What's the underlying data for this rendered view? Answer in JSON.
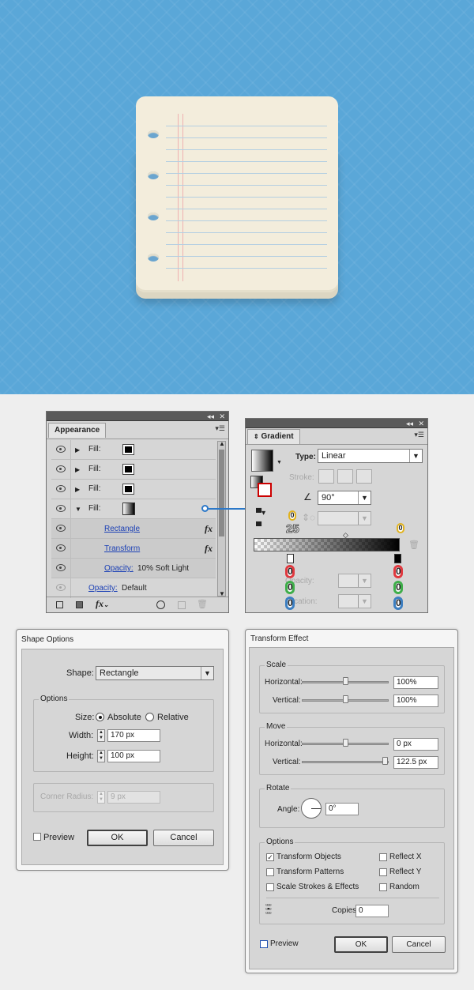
{
  "appearance": {
    "tab": "Appearance",
    "rows": [
      {
        "label": "Fill:"
      },
      {
        "label": "Fill:"
      },
      {
        "label": "Fill:"
      },
      {
        "label": "Fill:"
      }
    ],
    "effect_rectangle": "Rectangle",
    "effect_transform": "Transform",
    "opacity_label": "Opacity:",
    "opacity_value": "10% Soft Light",
    "opacity_label_2": "Opacity:",
    "opacity_value_2": "Default",
    "fx": "fx"
  },
  "gradient": {
    "tab": "Gradient",
    "type_label": "Type:",
    "type_value": "Linear",
    "stroke_label": "Stroke:",
    "angle_value": "90°",
    "location_value": "25",
    "opacity_label": "Opacity:",
    "location_label": "Location:",
    "callouts": [
      "0",
      "0",
      "0",
      "0",
      "0",
      "0",
      "0",
      "0"
    ]
  },
  "shape_options": {
    "title": "Shape Options",
    "shape_label": "Shape:",
    "shape_value": "Rectangle",
    "options_legend": "Options",
    "size_label": "Size:",
    "absolute": "Absolute",
    "relative": "Relative",
    "width_label": "Width:",
    "width_value": "170 px",
    "height_label": "Height:",
    "height_value": "100 px",
    "corner_label": "Corner Radius:",
    "corner_value": "9 px",
    "preview": "Preview",
    "ok": "OK",
    "cancel": "Cancel"
  },
  "transform": {
    "title": "Transform Effect",
    "scale": "Scale",
    "horizontal": "Horizontal:",
    "vertical": "Vertical:",
    "scale_h": "100%",
    "scale_v": "100%",
    "scale_h_level": 0.5,
    "scale_v_level": 0.5,
    "move": "Move",
    "move_h": "0 px",
    "move_v": "122.5 px",
    "move_h_level": 0.5,
    "move_v_level": 1.0,
    "horizontal_2": "Horizontal:",
    "vertical_2": "Vertical:",
    "rotate": "Rotate",
    "angle_label": "Angle:",
    "angle_value": "0°",
    "options": "Options",
    "transform_objects": "Transform Objects",
    "transform_patterns": "Transform Patterns",
    "scale_strokes": "Scale Strokes & Effects",
    "reflect_x": "Reflect X",
    "reflect_y": "Reflect Y",
    "random": "Random",
    "copies_label": "Copies",
    "copies_value": "0",
    "preview": "Preview",
    "ok": "OK",
    "cancel": "Cancel"
  },
  "colors": {
    "canvas": "#5aa7d8",
    "paper": "#f3eddc",
    "red": "#e0393f",
    "green": "#3fae4a",
    "blue": "#3d7fc1",
    "yellow": "#e1b31f"
  }
}
